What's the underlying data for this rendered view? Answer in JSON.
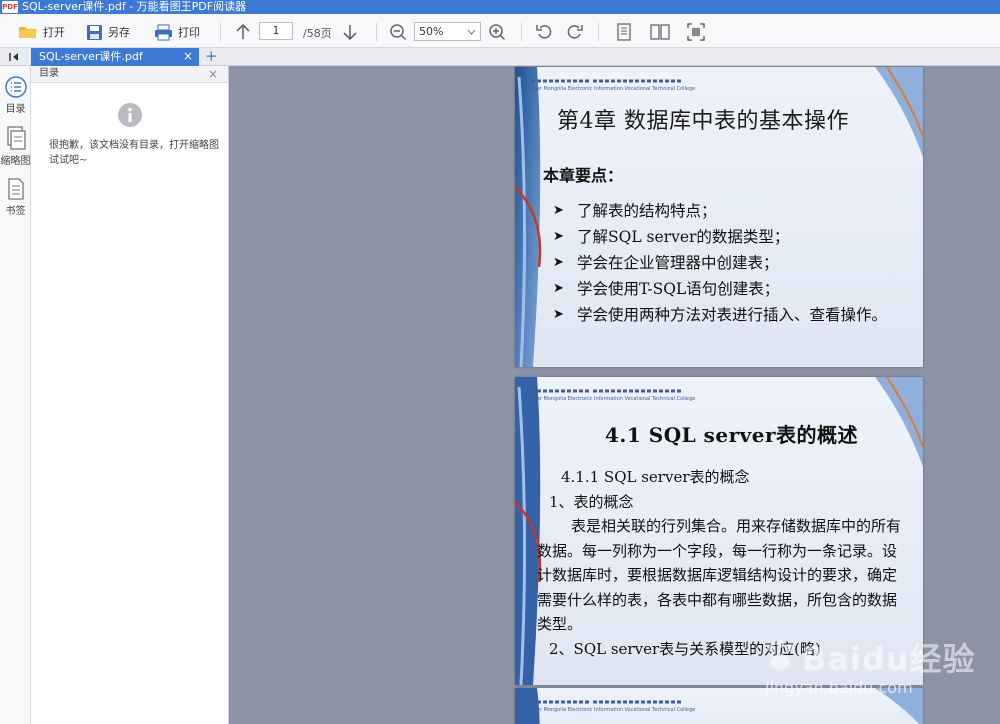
{
  "window": {
    "title": "SQL-server课件.pdf - 万能看图王PDF阅读器",
    "app_icon": "PDF"
  },
  "toolbar": {
    "open_label": "打开",
    "saveas_label": "另存",
    "print_label": "打印",
    "current_page": "1",
    "total_pages": "/58页",
    "zoom": "50%"
  },
  "tabs": [
    {
      "label": "SQL-server课件.pdf"
    }
  ],
  "leftbar": [
    {
      "label": "目录",
      "icon": "toc-icon"
    },
    {
      "label": "缩略图",
      "icon": "thumbnail-icon"
    },
    {
      "label": "书签",
      "icon": "bookmark-icon"
    }
  ],
  "panel": {
    "title": "目录",
    "empty_message": "很抱歉，该文档没有目录，打开缩略图试试吧~"
  },
  "slides": [
    {
      "header_en": "Inner Mongolia Electronic Information Vocational Technical College",
      "title": "第4章  数据库中表的基本操作",
      "subtitle": "本章要点：",
      "bullets": [
        "了解表的结构特点；",
        "了解SQL server的数据类型；",
        "学会在企业管理器中创建表；",
        "学会使用T-SQL语句创建表；",
        "学会使用两种方法对表进行插入、查看操作。"
      ]
    },
    {
      "header_en": "Inner Mongolia Electronic Information Vocational Technical College",
      "title": "4.1  SQL server表的概述",
      "section": "4.1.1 SQL server表的概念",
      "item1": "1、表的概念",
      "paragraph": "表是相关联的行列集合。用来存储数据库中的所有数据。每一列称为一个字段，每一行称为一条记录。设计数据库时，要根据数据库逻辑结构设计的要求，确定需要什么样的表，各表中都有哪些数据，所包含的数据类型。",
      "item2": "2、SQL server表与关系模型的对应(略)"
    },
    {
      "header_en": "Inner Mongolia Electronic Information Vocational Technical College"
    }
  ],
  "watermark": {
    "brand": "Baidu经验",
    "url": "jingyan.baidu.com"
  },
  "colors": {
    "accent": "#3c7ad6",
    "viewer_bg": "#8c93a5"
  }
}
